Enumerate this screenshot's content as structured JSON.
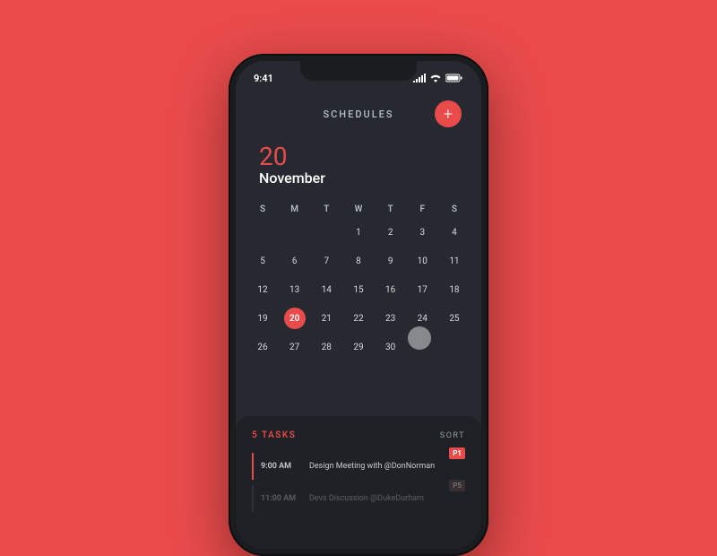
{
  "status": {
    "time": "9:41"
  },
  "header": {
    "title": "SCHEDULES"
  },
  "date": {
    "day": "20",
    "month": "November"
  },
  "calendar": {
    "weekdays": [
      "S",
      "M",
      "T",
      "W",
      "T",
      "F",
      "S"
    ],
    "rows": [
      [
        "",
        "",
        "",
        "1",
        "2",
        "3",
        "4"
      ],
      [
        "5",
        "6",
        "7",
        "8",
        "9",
        "10",
        "11"
      ],
      [
        "12",
        "13",
        "14",
        "15",
        "16",
        "17",
        "18"
      ],
      [
        "19",
        "20",
        "21",
        "22",
        "23",
        "24",
        "25"
      ],
      [
        "26",
        "27",
        "28",
        "29",
        "30",
        "",
        ""
      ]
    ],
    "selected": "20"
  },
  "tasks": {
    "title": "5 TASKS",
    "sort_label": "SORT",
    "items": [
      {
        "time": "9:00 AM",
        "desc": "Design Meeting with @DonNorman",
        "priority": "P1"
      },
      {
        "time": "11:00 AM",
        "desc": "Devs Discussion @DukeDurham",
        "priority": "P5"
      }
    ]
  }
}
